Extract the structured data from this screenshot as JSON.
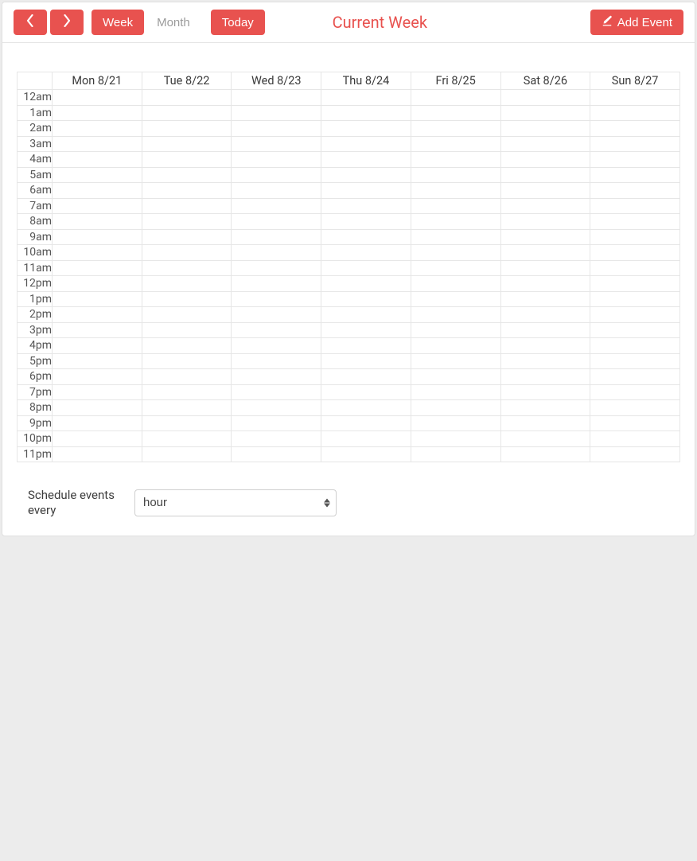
{
  "toolbar": {
    "prev_icon": "chevron-left",
    "next_icon": "chevron-right",
    "view_week": "Week",
    "view_month": "Month",
    "today": "Today",
    "title": "Current Week",
    "add_event": "Add Event"
  },
  "calendar": {
    "days": [
      "Mon 8/21",
      "Tue 8/22",
      "Wed 8/23",
      "Thu 8/24",
      "Fri 8/25",
      "Sat 8/26",
      "Sun 8/27"
    ],
    "hours": [
      "12am",
      "1am",
      "2am",
      "3am",
      "4am",
      "5am",
      "6am",
      "7am",
      "8am",
      "9am",
      "10am",
      "11am",
      "12pm",
      "1pm",
      "2pm",
      "3pm",
      "4pm",
      "5pm",
      "6pm",
      "7pm",
      "8pm",
      "9pm",
      "10pm",
      "11pm"
    ]
  },
  "footer": {
    "label": "Schedule events every",
    "select_value": "hour"
  }
}
